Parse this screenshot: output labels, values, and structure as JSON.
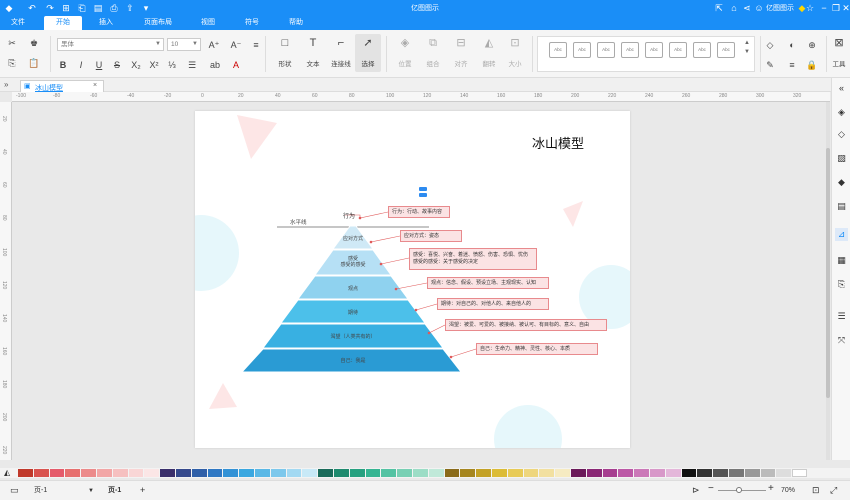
{
  "app": {
    "title": "亿图图示"
  },
  "menus": [
    "文件",
    "开始",
    "插入",
    "页面布局",
    "视图",
    "符号",
    "帮助"
  ],
  "account": {
    "name": "亿图图示"
  },
  "ribbon": {
    "font_name": "黑体",
    "font_size": "10",
    "big_tools": [
      "形状",
      "文本",
      "连接线",
      "选择"
    ],
    "arrange_tools": [
      "位置",
      "组合",
      "对齐",
      "翻转",
      "大小"
    ],
    "style_label": "Abc",
    "tools_label": "工具"
  },
  "doc_tab": {
    "name": "冰山模型"
  },
  "ruler_h": [
    "-100",
    "-80",
    "-60",
    "-40",
    "-20",
    "0",
    "20",
    "40",
    "60",
    "80",
    "100",
    "120",
    "140",
    "160",
    "180",
    "200",
    "220",
    "240",
    "260",
    "280",
    "300",
    "320"
  ],
  "ruler_v": [
    "20",
    "40",
    "60",
    "80",
    "100",
    "120",
    "140",
    "160",
    "180",
    "200",
    "220"
  ],
  "diagram": {
    "title": "冰山模型",
    "waterline": "水平线",
    "top_label": "行为",
    "layers": [
      "应对方式",
      "感受\n感受的感受",
      "观点",
      "期待",
      "渴望（人类共有的）",
      "自己：我是"
    ],
    "callouts": [
      "行为：行动、故事内容",
      "应对方式：姿态",
      "感受：喜悦、兴奋、着迷、愤怒、伤害、恐惧、忧伤\n感受的感受：关于感受的决定",
      "观点：信念、假设、预设立场、主观现实、认知",
      "期待：对自己的、对他人的、来自他人的",
      "渴望：被爱、可爱的、被接纳、被认可、有目标的、意义、自由",
      "自己：生命力、精神、灵性、核心、本质"
    ],
    "colors": {
      "layer_light": "#cfe9f6",
      "layer_mid": "#8fd2ef",
      "layer_deep": "#2a9bd4",
      "callout_fill": "#fbe3e4",
      "callout_border": "#e88a8d",
      "connector": "#e05a5a"
    }
  },
  "status": {
    "page_selector": "页-1",
    "page_tab": "页-1",
    "add_page": "+",
    "zoom": "70%"
  }
}
